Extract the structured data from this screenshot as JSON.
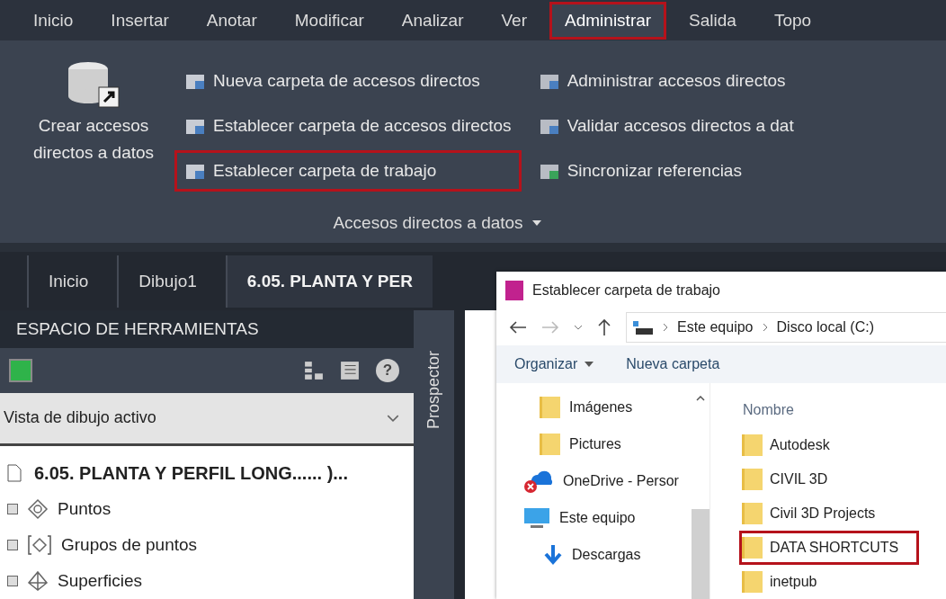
{
  "menu_tabs": [
    {
      "label": "Inicio",
      "selected": false,
      "highlighted": false
    },
    {
      "label": "Insertar",
      "selected": false,
      "highlighted": false
    },
    {
      "label": "Anotar",
      "selected": false,
      "highlighted": false
    },
    {
      "label": "Modificar",
      "selected": false,
      "highlighted": false
    },
    {
      "label": "Analizar",
      "selected": false,
      "highlighted": false
    },
    {
      "label": "Ver",
      "selected": false,
      "highlighted": false
    },
    {
      "label": "Administrar",
      "selected": true,
      "highlighted": true
    },
    {
      "label": "Salida",
      "selected": false,
      "highlighted": false
    },
    {
      "label": "Topo",
      "selected": false,
      "highlighted": false
    }
  ],
  "ribbon": {
    "big_button": {
      "label": "Crear accesos directos a datos"
    },
    "columns": [
      [
        {
          "label": "Nueva carpeta de accesos directos",
          "highlighted": false
        },
        {
          "label": "Establecer carpeta de accesos directos",
          "highlighted": false
        },
        {
          "label": "Establecer carpeta de trabajo",
          "highlighted": true
        }
      ],
      [
        {
          "label": "Administrar accesos directos",
          "highlighted": false
        },
        {
          "label": "Validar accesos directos a dat",
          "highlighted": false
        },
        {
          "label": "Sincronizar referencias",
          "highlighted": false
        }
      ]
    ],
    "panel_title": "Accesos directos a datos"
  },
  "doc_tabs": [
    {
      "label": "Inicio",
      "selected": false
    },
    {
      "label": "Dibujo1",
      "selected": false
    },
    {
      "label": "6.05. PLANTA Y PER",
      "selected": true
    }
  ],
  "palette": {
    "title": "ESPACIO DE HERRAMIENTAS",
    "help_glyph": "?",
    "view_select": "Vista de dibujo activo",
    "side_tab": "Prospector",
    "tree": {
      "label": "6.05. PLANTA Y PERFIL LONG...... )...",
      "children": [
        {
          "label": "Puntos",
          "kind": "points"
        },
        {
          "label": "Grupos de puntos",
          "kind": "point-groups"
        },
        {
          "label": "Superficies",
          "kind": "surfaces"
        }
      ]
    }
  },
  "dialog": {
    "title": "Establecer carpeta de trabajo",
    "path": [
      "Este equipo",
      "Disco local (C:)"
    ],
    "toolbar": [
      "Organizar",
      "Nueva carpeta"
    ],
    "nav": [
      {
        "label": "Imágenes",
        "kind": "folder"
      },
      {
        "label": "Pictures",
        "kind": "folder"
      },
      {
        "label": "OneDrive - Persor",
        "kind": "cloud"
      },
      {
        "label": "Este equipo",
        "kind": "pc"
      },
      {
        "label": "Descargas",
        "kind": "download"
      }
    ],
    "column_header": "Nombre",
    "files": [
      {
        "name": "Autodesk",
        "highlighted": false
      },
      {
        "name": "CIVIL 3D",
        "highlighted": false
      },
      {
        "name": "Civil 3D Projects",
        "highlighted": false
      },
      {
        "name": "DATA SHORTCUTS",
        "highlighted": true
      },
      {
        "name": "inetpub",
        "highlighted": false
      }
    ]
  }
}
